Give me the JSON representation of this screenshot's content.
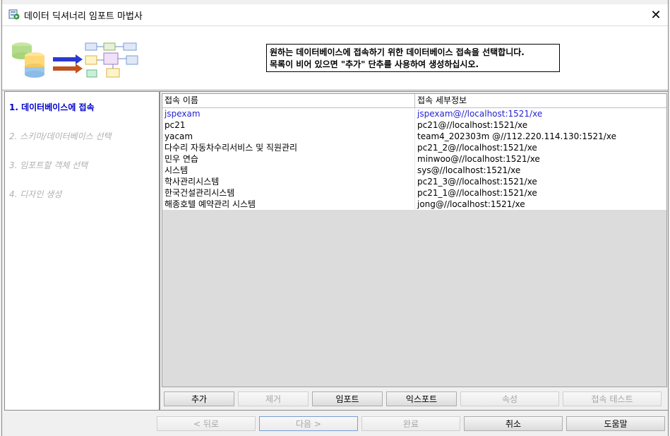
{
  "window": {
    "title": "데이터 딕셔너리 임포트 마법사",
    "close_glyph": "✕"
  },
  "banner": {
    "line1": "원하는 데이터베이스에 접속하기 위한 데이터베이스 접속을 선택합니다.",
    "line2": "목록이 비어 있으면 \"추가\" 단추를 사용하여 생성하십시오."
  },
  "steps": [
    {
      "label": "1. 데이터베이스에 접속",
      "state": "active"
    },
    {
      "label": "2. 스키마/데이터베이스 선택",
      "state": "disabled"
    },
    {
      "label": "3. 임포트할 객체 선택",
      "state": "disabled"
    },
    {
      "label": "4. 디자인 생성",
      "state": "disabled"
    }
  ],
  "grid": {
    "headers": [
      "접속 이름",
      "접속 세부정보"
    ],
    "rows": [
      {
        "name": "jspexam",
        "details": "jspexam@//localhost:1521/xe",
        "selected": true
      },
      {
        "name": "pc21",
        "details": "pc21@//localhost:1521/xe",
        "selected": false
      },
      {
        "name": "yacam",
        "details": "team4_202303m @//112.220.114.130:1521/xe",
        "selected": false
      },
      {
        "name": "다수리 자동차수리서비스 및 직원관리",
        "details": "pc21_2@//localhost:1521/xe",
        "selected": false
      },
      {
        "name": "민우 연습",
        "details": "minwoo@//localhost:1521/xe",
        "selected": false
      },
      {
        "name": "시스템",
        "details": "sys@//localhost:1521/xe",
        "selected": false
      },
      {
        "name": "학사관리시스템",
        "details": "pc21_3@//localhost:1521/xe",
        "selected": false
      },
      {
        "name": "한국건설관리시스템",
        "details": "pc21_1@//localhost:1521/xe",
        "selected": false
      },
      {
        "name": "해종호텔 예약관리 시스템",
        "details": "jong@//localhost:1521/xe",
        "selected": false
      }
    ]
  },
  "grid_buttons": {
    "add": "추가",
    "remove": "제거",
    "import": "임포트",
    "export": "익스포트",
    "properties": "속성",
    "test": "접속 테스트"
  },
  "footer_buttons": {
    "back": "< 뒤로",
    "next": "다음 >",
    "finish": "완료",
    "cancel": "취소",
    "help": "도움말"
  },
  "colors": {
    "active_step": "#0000cc",
    "selected_row": "#2424d0",
    "disabled_text": "#a6a6a6"
  }
}
